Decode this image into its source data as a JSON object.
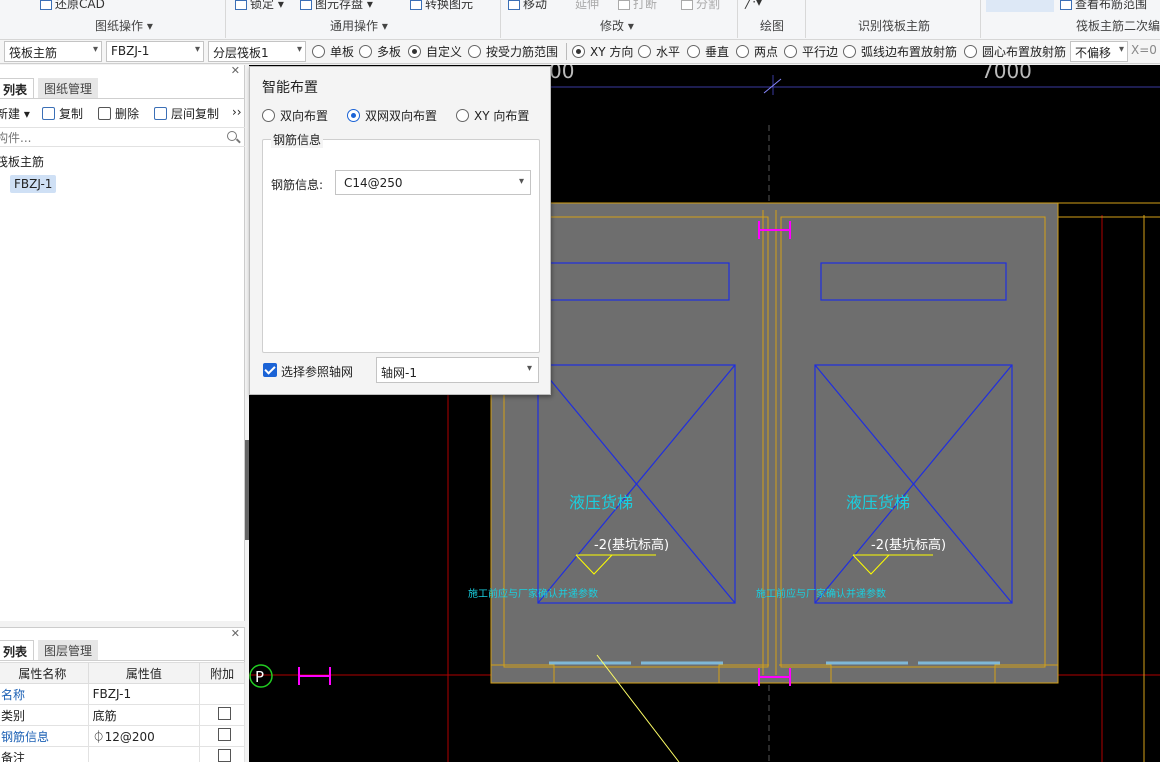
{
  "ribbon": {
    "top_items": [
      {
        "label": "还原CAD"
      },
      {
        "label": "锁定 ▾"
      },
      {
        "label": "图元存盘 ▾"
      },
      {
        "label": "转换图元"
      },
      {
        "label": "移动"
      },
      {
        "label": "延伸"
      },
      {
        "label": "打断"
      },
      {
        "label": "分割"
      },
      {
        "label": "查看布筋范围"
      }
    ],
    "groups": [
      {
        "label": "图纸操作 ▾"
      },
      {
        "label": "通用操作 ▾"
      },
      {
        "label": "修改 ▾"
      },
      {
        "label": "绘图"
      },
      {
        "label": "识别筏板主筋"
      },
      {
        "label": "筏板主筋二次编"
      }
    ]
  },
  "toolbar": {
    "element_type": "筏板主筋",
    "element_name": "FBZJ-1",
    "layer": "分层筏板1",
    "board_options": [
      {
        "label": "单板",
        "checked": false
      },
      {
        "label": "多板",
        "checked": false
      },
      {
        "label": "自定义",
        "checked": true
      },
      {
        "label": "按受力筋范围",
        "checked": false
      }
    ],
    "direction_options": [
      {
        "label": "XY 方向",
        "checked": true
      },
      {
        "label": "水平",
        "checked": false
      },
      {
        "label": "垂直",
        "checked": false
      },
      {
        "label": "两点",
        "checked": false
      },
      {
        "label": "平行边",
        "checked": false
      },
      {
        "label": "弧线边布置放射筋",
        "checked": false
      },
      {
        "label": "圆心布置放射筋",
        "checked": false
      }
    ],
    "offset": "不偏移",
    "x_label": "X=",
    "x_value": "0"
  },
  "left_panel": {
    "tabs": [
      {
        "label": "列表",
        "active": true
      },
      {
        "label": "图纸管理",
        "active": false
      }
    ],
    "actions": [
      {
        "label": "新建 ▾"
      },
      {
        "label": "复制"
      },
      {
        "label": "删除"
      },
      {
        "label": "层间复制"
      }
    ],
    "more": "››",
    "search_placeholder": "构件...",
    "tree_group": "筏板主筋",
    "tree_item": "FBZJ-1"
  },
  "prop_panel": {
    "tabs": [
      {
        "label": "列表",
        "active": true
      },
      {
        "label": "图层管理",
        "active": false
      }
    ],
    "headers": {
      "name": "属性名称",
      "value": "属性值",
      "extra": "附加"
    },
    "rows": [
      {
        "name": "名称",
        "value": "FBZJ-1",
        "checkbox": false,
        "link": true
      },
      {
        "name": "类别",
        "value": "底筋",
        "checkbox": true,
        "link": false
      },
      {
        "name": "钢筋信息",
        "value": "⏀12@200",
        "checkbox": true,
        "link": true
      },
      {
        "name": "备注",
        "value": "",
        "checkbox": true,
        "link": false
      }
    ]
  },
  "popup": {
    "title": "智能布置",
    "modes": [
      {
        "label": "双向布置",
        "checked": false
      },
      {
        "label": "双网双向布置",
        "checked": true
      },
      {
        "label": "XY 向布置",
        "checked": false
      }
    ],
    "group_title": "钢筋信息",
    "rebar_label": "钢筋信息:",
    "rebar_value": "C14@250",
    "ref_axis_label": "选择参照轴网",
    "ref_axis_checked": true,
    "axis_value": "轴网-1"
  },
  "canvas": {
    "dimension_left": "00",
    "dimension_right": "7000",
    "room_labels": [
      "液压货梯",
      "液压货梯"
    ],
    "elevation_labels": [
      "-2(基坑标高)",
      "-2(基坑标高)"
    ],
    "notes": [
      "施工前应与厂家确认并递参数",
      "施工前应与厂家确认并递参数"
    ],
    "axis_bubble": "P",
    "colors": {
      "slab": "#6e6e6e",
      "outline": "#d4a017",
      "blue": "#1f2ee0",
      "cyan": "#19d0e0",
      "magenta": "#ff00ff",
      "red": "#b00000"
    }
  }
}
